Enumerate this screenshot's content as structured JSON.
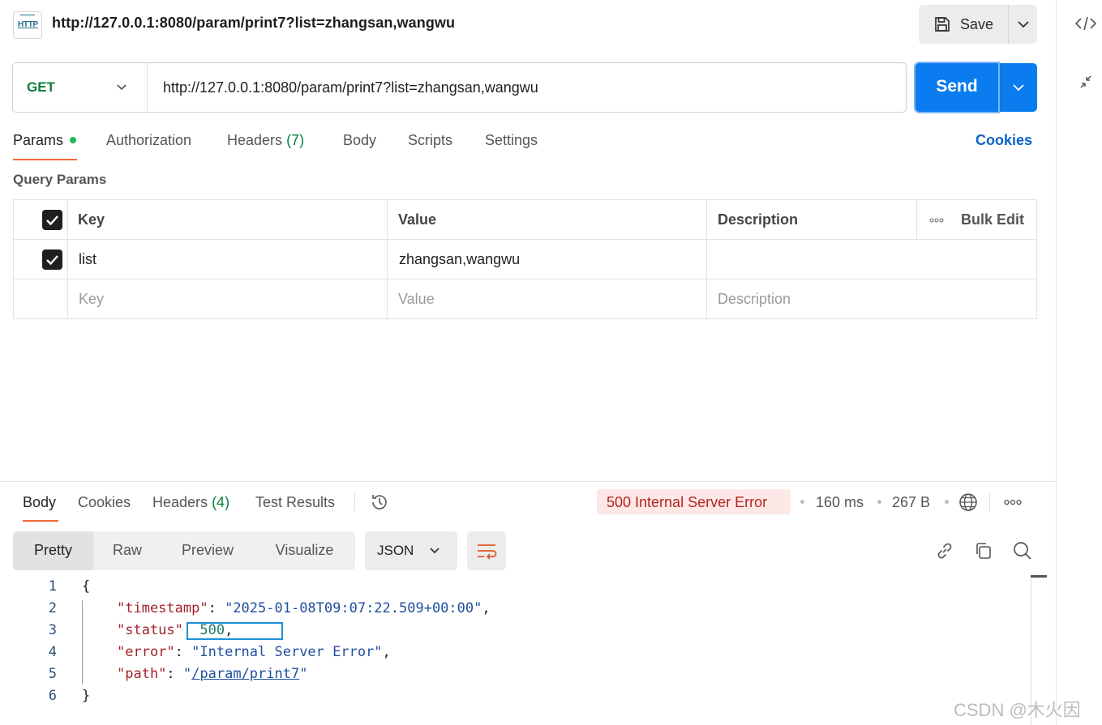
{
  "request": {
    "title": "http://127.0.0.1:8080/param/print7?list=zhangsan,wangwu",
    "method": "GET",
    "url": "http://127.0.0.1:8080/param/print7?list=zhangsan,wangwu",
    "http_badge": "HTTP"
  },
  "toolbar": {
    "save_label": "Save",
    "send_label": "Send"
  },
  "request_tabs": {
    "params": "Params",
    "authorization": "Authorization",
    "headers": "Headers",
    "headers_count": "(7)",
    "body": "Body",
    "scripts": "Scripts",
    "settings": "Settings",
    "cookies": "Cookies"
  },
  "query_params": {
    "title": "Query Params",
    "headers": {
      "key": "Key",
      "value": "Value",
      "description": "Description",
      "bulk_edit": "Bulk Edit"
    },
    "rows": [
      {
        "checked": true,
        "key": "list",
        "value": "zhangsan,wangwu",
        "description": ""
      }
    ],
    "placeholders": {
      "key": "Key",
      "value": "Value",
      "description": "Description"
    }
  },
  "response_tabs": {
    "body": "Body",
    "cookies": "Cookies",
    "headers": "Headers",
    "headers_count": "(4)",
    "test_results": "Test Results"
  },
  "response_meta": {
    "status": "500 Internal Server Error",
    "time": "160 ms",
    "size": "267 B"
  },
  "view_modes": {
    "pretty": "Pretty",
    "raw": "Raw",
    "preview": "Preview",
    "visualize": "Visualize",
    "format": "JSON"
  },
  "code": {
    "line_numbers": [
      "1",
      "2",
      "3",
      "4",
      "5",
      "6"
    ],
    "open_brace": "{",
    "close_brace": "}",
    "timestamp_key": "\"timestamp\"",
    "timestamp_val": "\"2025-01-08T09:07:22.509+00:00\"",
    "status_key": "\"status\"",
    "status_val": "500",
    "error_key": "\"error\"",
    "error_val": "\"Internal Server Error\"",
    "path_key": "\"path\"",
    "path_val": "/param/print7"
  },
  "watermark": "CSDN @木火因",
  "colors": {
    "accent": "#0a7cf0",
    "tab_underline": "#f26b3a",
    "status_error": "#b3261e",
    "method_get": "#0a7d3e"
  }
}
